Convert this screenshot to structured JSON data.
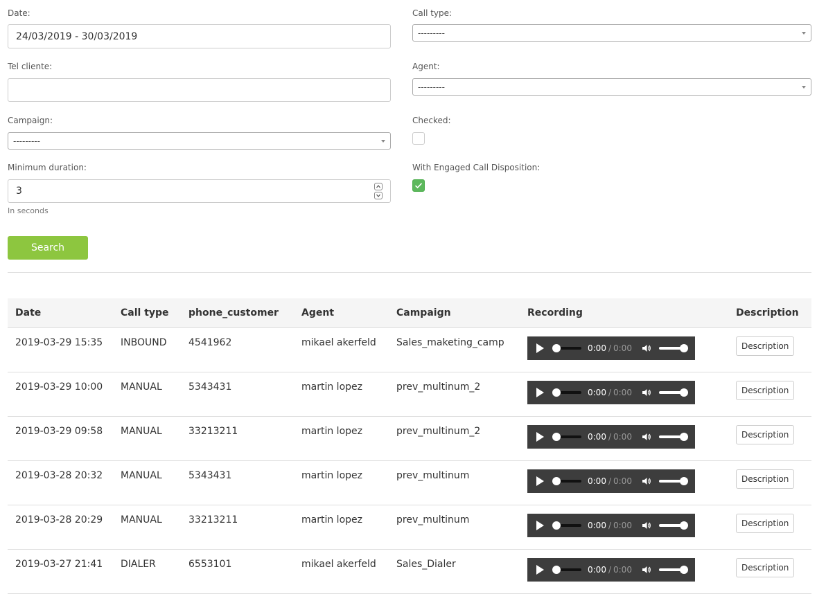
{
  "filters": {
    "date": {
      "label": "Date:",
      "value": "24/03/2019 - 30/03/2019"
    },
    "tel_cliente": {
      "label": "Tel cliente:",
      "value": ""
    },
    "campaign": {
      "label": "Campaign:",
      "selected": "---------"
    },
    "min_duration": {
      "label": "Minimum duration:",
      "value": "3",
      "help": "In seconds"
    },
    "call_type": {
      "label": "Call type:",
      "selected": "---------"
    },
    "agent": {
      "label": "Agent:",
      "selected": "---------"
    },
    "checked": {
      "label": "Checked:",
      "value": false
    },
    "engaged": {
      "label": "With Engaged Call Disposition:",
      "value": true
    },
    "search_label": "Search"
  },
  "table": {
    "headers": [
      "Date",
      "Call type",
      "phone_customer",
      "Agent",
      "Campaign",
      "Recording",
      "Description"
    ],
    "rows": [
      {
        "date": "2019-03-29 15:35",
        "type": "INBOUND",
        "phone": "4541962",
        "agent": "mikael akerfeld",
        "campaign": "Sales_maketing_camp"
      },
      {
        "date": "2019-03-29 10:00",
        "type": "MANUAL",
        "phone": "5343431",
        "agent": "martin lopez",
        "campaign": "prev_multinum_2"
      },
      {
        "date": "2019-03-29 09:58",
        "type": "MANUAL",
        "phone": "33213211",
        "agent": "martin lopez",
        "campaign": "prev_multinum_2"
      },
      {
        "date": "2019-03-28 20:32",
        "type": "MANUAL",
        "phone": "5343431",
        "agent": "martin lopez",
        "campaign": "prev_multinum"
      },
      {
        "date": "2019-03-28 20:29",
        "type": "MANUAL",
        "phone": "33213211",
        "agent": "martin lopez",
        "campaign": "prev_multinum"
      },
      {
        "date": "2019-03-27 21:41",
        "type": "DIALER",
        "phone": "6553101",
        "agent": "mikael akerfeld",
        "campaign": "Sales_Dialer"
      }
    ],
    "player": {
      "current": "0:00",
      "separator": "/",
      "duration": "0:00"
    },
    "description_label": "Description"
  },
  "colors": {
    "accent": "#8dc63f",
    "checkbox_on": "#5cb85c",
    "player_bg": "#3d3d3d"
  }
}
